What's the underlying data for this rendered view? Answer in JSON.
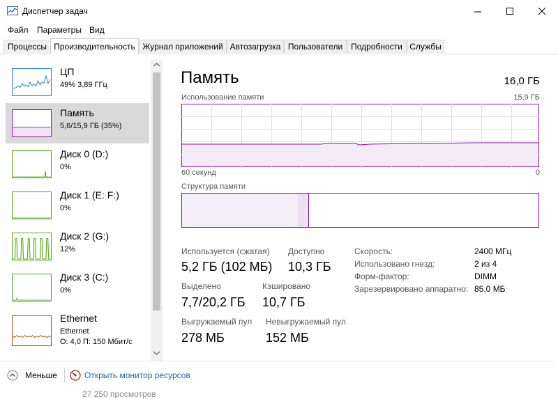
{
  "window": {
    "title": "Диспетчер задач",
    "accent": "#8b12ae"
  },
  "menu": [
    "Файл",
    "Параметры",
    "Вид"
  ],
  "tabs": [
    "Процессы",
    "Производительность",
    "Журнал приложений",
    "Автозагрузка",
    "Пользователи",
    "Подробности",
    "Службы"
  ],
  "active_tab": 1,
  "sidebar": {
    "items": [
      {
        "name": "ЦП",
        "sub": "49% 3,89 ГГц",
        "sub2": "",
        "icon": "cpu-graph"
      },
      {
        "name": "Память",
        "sub": "5,6/15,9 ГБ (35%)",
        "sub2": "",
        "icon": "memory-graph"
      },
      {
        "name": "Диск 0 (D:)",
        "sub": "0%",
        "sub2": "",
        "icon": "disk-graph"
      },
      {
        "name": "Диск 1 (E: F:)",
        "sub": "0%",
        "sub2": "",
        "icon": "disk-graph"
      },
      {
        "name": "Диск 2 (G:)",
        "sub": "12%",
        "sub2": "",
        "icon": "disk-graph"
      },
      {
        "name": "Диск 3 (C:)",
        "sub": "0%",
        "sub2": "",
        "icon": "disk-graph"
      },
      {
        "name": "Ethernet",
        "sub": "Ethernet",
        "sub2": "О: 4,0  П: 150 Мбит/с",
        "icon": "ethernet-graph"
      }
    ]
  },
  "main": {
    "title": "Память",
    "total": "16,0 ГБ",
    "usage_label": "Использование памяти",
    "usage_max": "15,9 ГБ",
    "axis_left": "60 секунд",
    "axis_right": "0",
    "structure_label": "Структура памяти",
    "usage_fraction": 0.35,
    "stats": {
      "in_use_label": "Используется (сжатая)",
      "in_use_value": "5,2 ГБ (102 МБ)",
      "available_label": "Доступно",
      "available_value": "10,3 ГБ",
      "committed_label": "Выделено",
      "committed_value": "7,7/20,2 ГБ",
      "cached_label": "Кэшировано",
      "cached_value": "10,7 ГБ",
      "paged_label": "Выгружаемый пул",
      "paged_value": "278 МБ",
      "nonpaged_label": "Невыгружаемый пул",
      "nonpaged_value": "152 МБ"
    },
    "specs": [
      {
        "label": "Скорость:",
        "value": "2400 МГц"
      },
      {
        "label": "Использовано гнезд:",
        "value": "2 из 4"
      },
      {
        "label": "Форм-фактор:",
        "value": "DIMM"
      },
      {
        "label": "Зарезервировано аппаратно:",
        "value": "85,0 МБ"
      }
    ]
  },
  "footer": {
    "less_label": "Меньше",
    "monitor_label": "Открыть монитор ресурсов",
    "bottom_text": "27 250 просмотров"
  }
}
